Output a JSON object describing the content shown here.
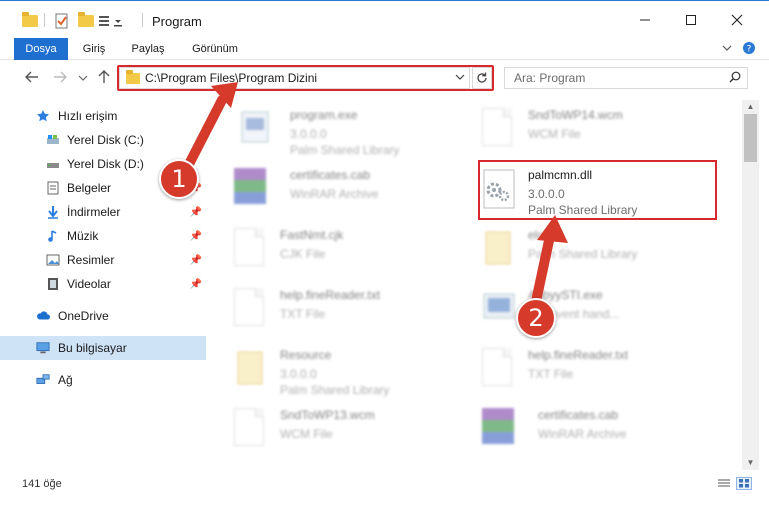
{
  "window": {
    "title": "Program",
    "minimize_icon": "minimize-icon",
    "maximize_icon": "maximize-icon",
    "close_icon": "close-icon"
  },
  "ribbon": {
    "tabs": [
      {
        "label": "Dosya",
        "active": true
      },
      {
        "label": "Giriş"
      },
      {
        "label": "Paylaş"
      },
      {
        "label": "Görünüm"
      }
    ],
    "expand_icon": "chevron-down-icon",
    "help_icon": "help-icon"
  },
  "navigation": {
    "back_icon": "arrow-left-icon",
    "forward_icon": "arrow-right-icon",
    "recent_icon": "chevron-down-icon",
    "up_icon": "arrow-up-icon"
  },
  "address": {
    "path": "C:\\Program Files\\Program Dizini",
    "refresh_icon": "refresh-icon"
  },
  "search": {
    "placeholder": "Ara: Program",
    "icon": "search-icon"
  },
  "sidebar": {
    "items": [
      {
        "label": "Hızlı erişim",
        "icon": "star-icon",
        "pinned": false
      },
      {
        "label": "Yerel Disk (C:)",
        "icon": "drive-icon",
        "pinned": false
      },
      {
        "label": "Yerel Disk (D:)",
        "icon": "drive-icon",
        "pinned": true
      },
      {
        "label": "Belgeler",
        "icon": "documents-icon",
        "pinned": true
      },
      {
        "label": "İndirmeler",
        "icon": "download-icon",
        "pinned": true
      },
      {
        "label": "Müzik",
        "icon": "music-icon",
        "pinned": true
      },
      {
        "label": "Resimler",
        "icon": "pictures-icon",
        "pinned": true
      },
      {
        "label": "Videolar",
        "icon": "video-icon",
        "pinned": true
      },
      {
        "label": "OneDrive",
        "icon": "cloud-icon",
        "pinned": false
      },
      {
        "label": "Bu bilgisayar",
        "icon": "computer-icon",
        "pinned": false,
        "selected": true
      },
      {
        "label": "Ağ",
        "icon": "network-icon",
        "pinned": false
      }
    ]
  },
  "files": [
    {
      "name": "program.exe",
      "line1": "3.0.0.0",
      "line2": "Palm Shared Library",
      "icon": "exe-icon",
      "blurred": true
    },
    {
      "name": "SndToWP14.wcm",
      "line1": "WCM File",
      "line2": "",
      "icon": "page-icon",
      "blurred": true
    },
    {
      "name": "certificates.cab",
      "line1": "WinRAR Archive",
      "line2": "",
      "icon": "rar-icon",
      "blurred": true
    },
    {
      "name": "palmcmn.dll",
      "line1": "3.0.0.0",
      "line2": "Palm Shared Library",
      "icon": "dll-gear-icon",
      "blurred": false
    },
    {
      "name": "FastNmt.cjk",
      "line1": "CJK File",
      "line2": "",
      "icon": "page-icon",
      "blurred": true
    },
    {
      "name": "elo",
      "line1": "",
      "line2": "Palm Shared Library",
      "icon": "folder-page-icon",
      "blurred": true
    },
    {
      "name": "help.fineReader.txt",
      "line1": "TXT File",
      "line2": "",
      "icon": "page-icon",
      "blurred": true
    },
    {
      "name": "AbbyySTI.exe",
      "line1": "STI event hand...",
      "line2": "",
      "icon": "exe-icon",
      "blurred": true
    },
    {
      "name": "Resource",
      "line1": "3.0.0.0",
      "line2": "Palm Shared Library",
      "icon": "folder-page-icon",
      "blurred": true
    },
    {
      "name": "help.fineReader.txt",
      "line1": "TXT File",
      "line2": "",
      "icon": "page-icon",
      "blurred": true
    },
    {
      "name": "SndToWP13.wcm",
      "line1": "WCM File",
      "line2": "",
      "icon": "page-icon",
      "blurred": true
    },
    {
      "name": "certificates.cab",
      "line1": "WinRAR Archive",
      "line2": "",
      "icon": "rar-icon",
      "blurred": true
    }
  ],
  "status": {
    "count": "141 öğe",
    "details_view_icon": "details-view-icon",
    "large_icons_view_icon": "large-icons-view-icon"
  },
  "annotations": {
    "callout_1": "1",
    "callout_2": "2",
    "color": "#d9282b"
  },
  "colors": {
    "accent": "#1f6fd1",
    "selection": "#cfe3f7"
  }
}
